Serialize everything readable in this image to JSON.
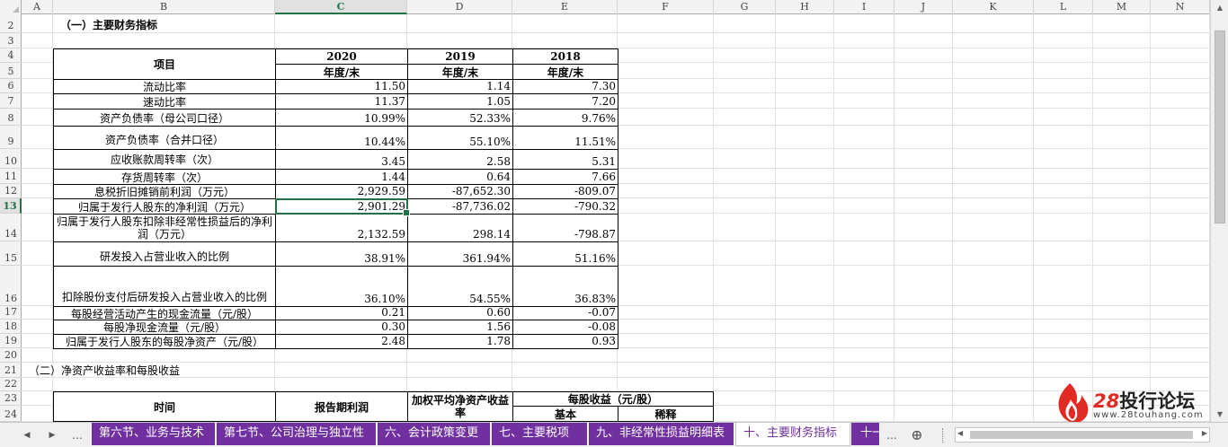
{
  "columns": [
    "A",
    "B",
    "C",
    "D",
    "E",
    "F",
    "G",
    "H",
    "I",
    "J",
    "K",
    "L",
    "M",
    "N"
  ],
  "active_column": "C",
  "rows": [
    "2",
    "3",
    "4",
    "5",
    "6",
    "7",
    "8",
    "9",
    "10",
    "11",
    "12",
    "13",
    "14",
    "15",
    "16",
    "17",
    "18",
    "19",
    "20",
    "21",
    "22",
    "23",
    "24"
  ],
  "active_row": "13",
  "section1_title": "（一）主要财务指标",
  "table1": {
    "item_header": "项目",
    "years": [
      "2020",
      "2019",
      "2018"
    ],
    "period_label": "年度/末",
    "rows": [
      {
        "label": "流动比率",
        "v2020": "11.50",
        "v2019": "1.14",
        "v2018": "7.30"
      },
      {
        "label": "速动比率",
        "v2020": "11.37",
        "v2019": "1.05",
        "v2018": "7.20"
      },
      {
        "label": "资产负债率（母公司口径）",
        "v2020": "10.99%",
        "v2019": "52.33%",
        "v2018": "9.76%"
      },
      {
        "label": "资产负债率（合并口径）",
        "v2020": "10.44%",
        "v2019": "55.10%",
        "v2018": "11.51%"
      },
      {
        "label": "应收账款周转率（次）",
        "v2020": "3.45",
        "v2019": "2.58",
        "v2018": "5.31"
      },
      {
        "label": "存货周转率（次）",
        "v2020": "1.44",
        "v2019": "0.64",
        "v2018": "7.66"
      },
      {
        "label": "息税折旧摊销前利润（万元）",
        "v2020": "2,929.59",
        "v2019": "-87,652.30",
        "v2018": "-809.07"
      },
      {
        "label": "归属于发行人股东的净利润（万元）",
        "v2020": "2,901.29",
        "v2019": "-87,736.02",
        "v2018": "-790.32"
      },
      {
        "label": "归属于发行人股东扣除非经常性损益后的净利润（万元）",
        "v2020": "2,132.59",
        "v2019": "298.14",
        "v2018": "-798.87"
      },
      {
        "label": "研发投入占营业收入的比例",
        "v2020": "38.91%",
        "v2019": "361.94%",
        "v2018": "51.16%"
      },
      {
        "label": "扣除股份支付后研发投入占营业收入的比例",
        "v2020": "36.10%",
        "v2019": "54.55%",
        "v2018": "36.83%"
      },
      {
        "label": "每股经营活动产生的现金流量（元/股）",
        "v2020": "0.21",
        "v2019": "0.60",
        "v2018": "-0.07"
      },
      {
        "label": "每股净现金流量（元/股）",
        "v2020": "0.30",
        "v2019": "1.56",
        "v2018": "-0.08"
      },
      {
        "label": "归属于发行人股东的每股净资产（元/股）",
        "v2020": "2.48",
        "v2019": "1.78",
        "v2018": "0.93"
      }
    ]
  },
  "section2_title": "（二）净资产收益率和每股收益",
  "table2": {
    "time_header": "时间",
    "profit_header": "报告期利润",
    "roe_header": "加权平均净资产收益率",
    "eps_header": "每股收益（元/股）",
    "basic": "基本",
    "diluted": "稀释"
  },
  "sheet_tabs": [
    "第六节、业务与技术",
    "第七节、公司治理与独立性",
    "六、会计政策变更",
    "七、主要税项",
    "九、非经常性损益明细表",
    "十、主要财务指标",
    "十一"
  ],
  "active_tab": "十、主要财务指标",
  "nav": {
    "prev": "◀",
    "next": "▶",
    "more": "...",
    "add": "⊕"
  },
  "logo": {
    "number": "28",
    "name": "投行论坛",
    "url": "www.28touhang.com"
  },
  "colors": {
    "tab_bg": "#7030a0",
    "selection": "#217346",
    "logo_red": "#e02a24"
  }
}
